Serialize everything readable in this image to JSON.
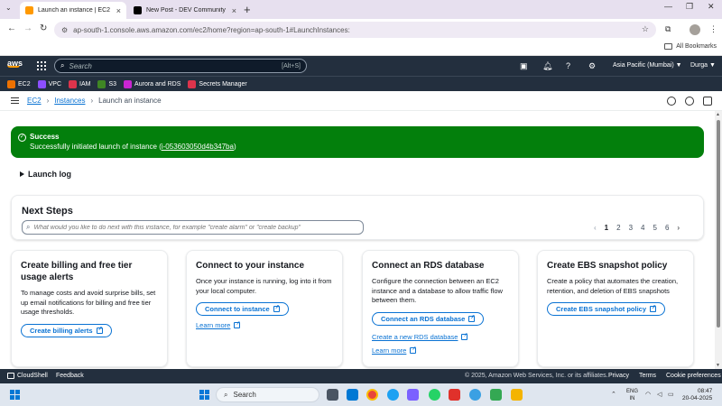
{
  "browser": {
    "tabs": [
      {
        "title": "Launch an instance | EC2 | ap-sou",
        "favicon_color": "#ff9900"
      },
      {
        "title": "New Post - DEV Community",
        "favicon_color": "#000000"
      }
    ],
    "url_site": "⚙",
    "url": "ap-south-1.console.aws.amazon.com/ec2/home?region=ap-south-1#LaunchInstances:",
    "bookmarks_label": "All Bookmarks"
  },
  "aws_nav": {
    "logo": "aws",
    "search_placeholder": "Search",
    "search_shortcut": "[Alt+S]",
    "region": "Asia Pacific (Mumbai) ▼",
    "user": "Durga ▼"
  },
  "services": [
    {
      "label": "EC2",
      "color": "#ed7100"
    },
    {
      "label": "VPC",
      "color": "#8c4fff"
    },
    {
      "label": "IAM",
      "color": "#dd344c"
    },
    {
      "label": "S3",
      "color": "#3f8624"
    },
    {
      "label": "Aurora and RDS",
      "color": "#c925d1"
    },
    {
      "label": "Secrets Manager",
      "color": "#dd344c"
    }
  ],
  "breadcrumb": {
    "ec2": "EC2",
    "instances": "Instances",
    "current": "Launch an instance"
  },
  "success": {
    "title": "Success",
    "message_prefix": "Successfully initiated launch of instance (",
    "instance_id": "i-053603050d4b347ba",
    "message_suffix": ")"
  },
  "launch_log": "Launch log",
  "next_steps": {
    "title": "Next Steps",
    "placeholder": "What would you like to do next with this instance, for example \"create alarm\" or \"create backup\"",
    "pages": [
      "1",
      "2",
      "3",
      "4",
      "5",
      "6"
    ]
  },
  "cards": [
    {
      "title": "Create billing and free tier usage alerts",
      "desc": "To manage costs and avoid surprise bills, set up email notifications for billing and free tier usage thresholds.",
      "button": "Create billing alerts"
    },
    {
      "title": "Connect to your instance",
      "desc": "Once your instance is running, log into it from your local computer.",
      "button": "Connect to instance",
      "link": "Learn more"
    },
    {
      "title": "Connect an RDS database",
      "desc": "Configure the connection between an EC2 instance and a database to allow traffic flow between them.",
      "button": "Connect an RDS database",
      "link1": "Create a new RDS database",
      "link2": "Learn more"
    },
    {
      "title": "Create EBS snapshot policy",
      "desc": "Create a policy that automates the creation, retention, and deletion of EBS snapshots",
      "button": "Create EBS snapshot policy"
    }
  ],
  "footer": {
    "cloudshell": "CloudShell",
    "feedback": "Feedback",
    "copyright": "© 2025, Amazon Web Services, Inc. or its affiliates.",
    "privacy": "Privacy",
    "terms": "Terms",
    "cookies": "Cookie preferences"
  },
  "taskbar": {
    "search": "Search",
    "lang1": "ENG",
    "lang2": "IN",
    "time": "08:47",
    "date": "20-04-2025"
  }
}
